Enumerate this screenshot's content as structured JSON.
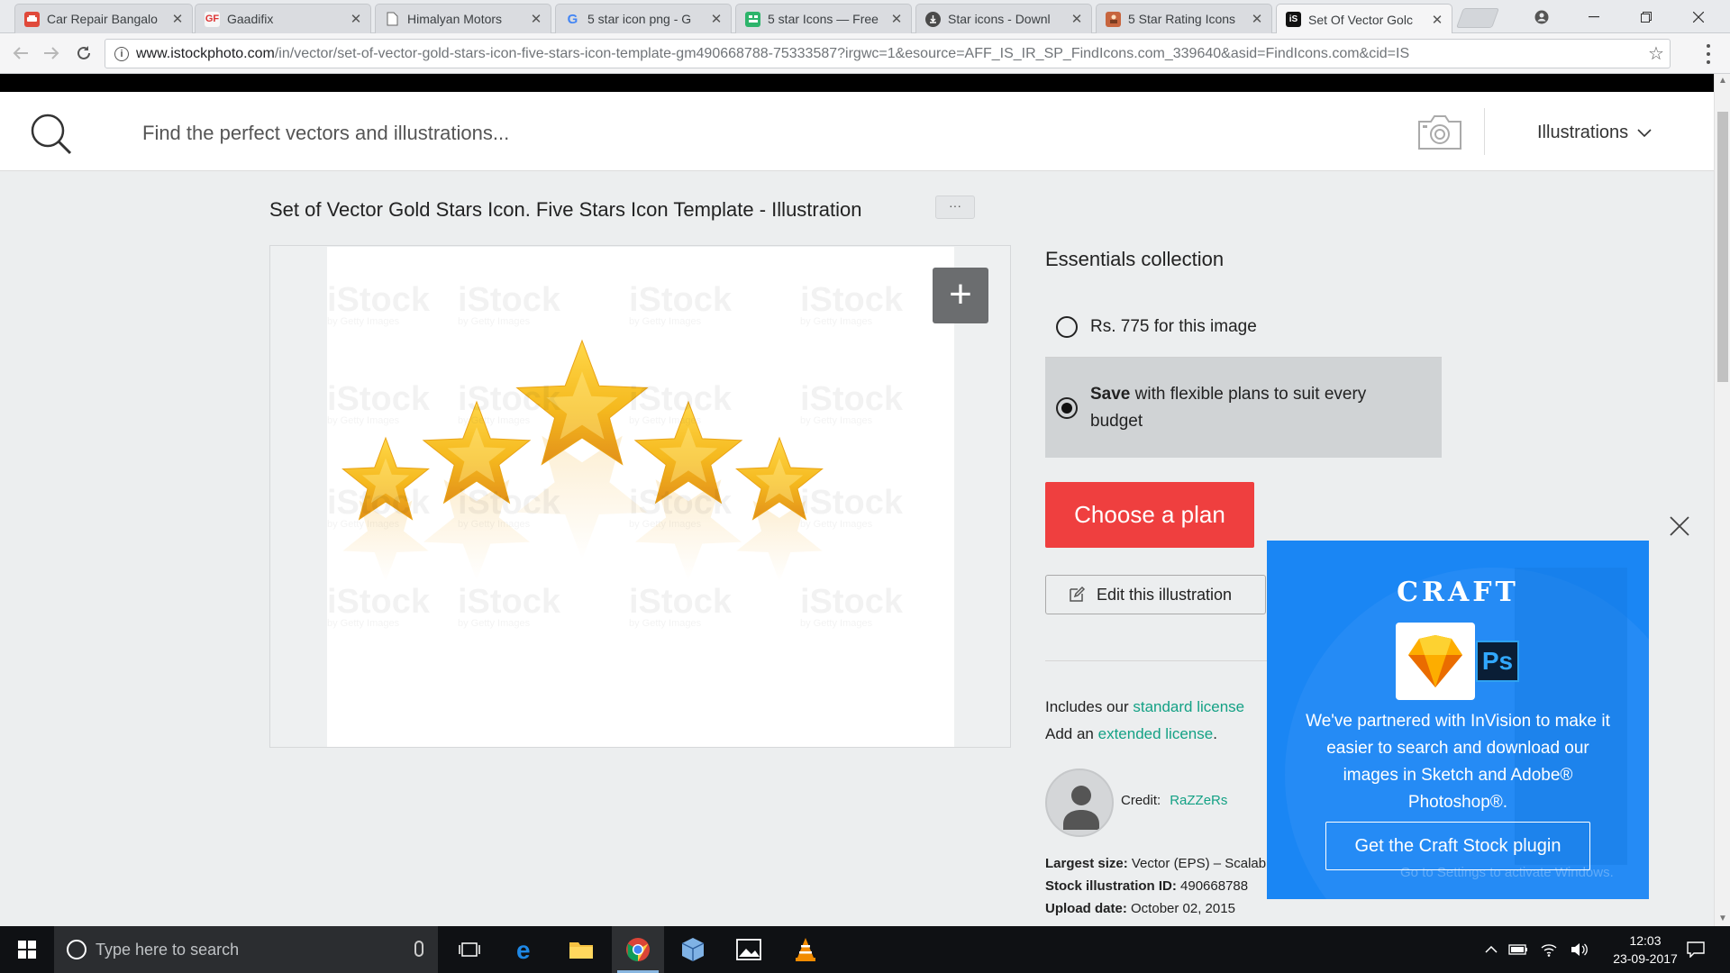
{
  "browser": {
    "tabs": [
      {
        "title": "Car Repair Bangalo",
        "icon": "car-icon",
        "color": "#e0493a"
      },
      {
        "title": "Gaadifix",
        "icon": "gaadifix-logo-icon",
        "color": "#f0f0f0"
      },
      {
        "title": "Himalyan Motors",
        "icon": "page-icon",
        "color": "#ffffff"
      },
      {
        "title": "5 star icon png - G",
        "icon": "google-icon",
        "color": "#ffffff"
      },
      {
        "title": "5 star Icons — Free",
        "icon": "icons-site-icon",
        "color": "#2db46b"
      },
      {
        "title": "Star icons - Downl",
        "icon": "download-site-icon",
        "color": "#4a4a4a"
      },
      {
        "title": "5 Star Rating Icons",
        "icon": "image-site-icon",
        "color": "#c7653e"
      },
      {
        "title": "Set Of Vector Golc",
        "icon": "istock-icon",
        "color": "#111111"
      }
    ],
    "url_host": "www.istockphoto.com",
    "url_path": "/in/vector/set-of-vector-gold-stars-icon-five-stars-icon-template-gm490668788-75333587?irgwc=1&esource=AFF_IS_IR_SP_FindIcons.com_339640&asid=FindIcons.com&cid=IS"
  },
  "search": {
    "placeholder": "Find the perfect vectors and illustrations...",
    "media_type": "Illustrations"
  },
  "asset": {
    "title": "Set of Vector Gold Stars Icon. Five Stars Icon Template - Illustration",
    "more_label": "···",
    "zoom_label": "+",
    "star_count": 5,
    "star_color": "#f5b91e",
    "watermark_brand": "iStock",
    "watermark_sub": "by Getty Images"
  },
  "purchase": {
    "collection": "Essentials collection",
    "option1": "Rs. 775 for this image",
    "option2_bold": "Save",
    "option2_rest": " with flexible plans to suit every budget",
    "option1_selected": false,
    "option2_selected": true,
    "cta": "Choose a plan",
    "cta_color": "#ef3f3f",
    "edit": "Edit this illustration",
    "license_prefix": "Includes our ",
    "license_link": "standard license",
    "extended_prefix": "Add an ",
    "extended_link": "extended license",
    "extended_suffix": ".",
    "link_color": "#14a185",
    "credit_label": "Credit:",
    "credit_name": "RaZZeRs",
    "largest_size_label": "Largest size:",
    "largest_size_value": " Vector (EPS) – Scalab",
    "id_label": "Stock illustration ID:",
    "id_value": " 490668788",
    "upload_label": "Upload date:",
    "upload_value": " October 02, 2015"
  },
  "popup": {
    "brand": "CRAFT",
    "ps_label": "Ps",
    "text": "We've partnered with InVision to make it easier to search and download our images in Sketch and Adobe® Photoshop®.",
    "button": "Get the Craft Stock plugin",
    "bg_color": "#1a86f4"
  },
  "os": {
    "activation_watermark": "Go to Settings to activate Windows.",
    "search_placeholder": "Type here to search",
    "time": "12:03",
    "date": "23-09-2017"
  }
}
